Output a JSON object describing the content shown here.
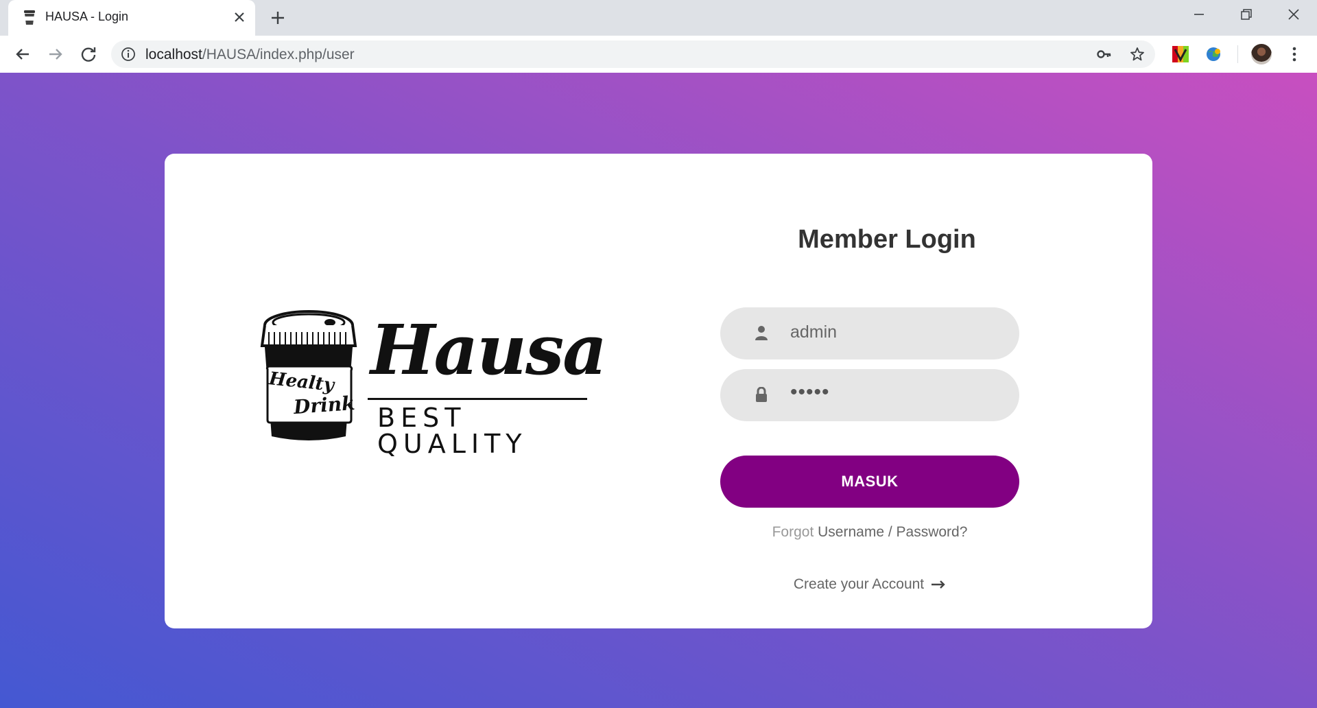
{
  "browser": {
    "tab_title": "HAUSA - Login",
    "url_host": "localhost",
    "url_path": "/HAUSA/index.php/user"
  },
  "login": {
    "title": "Member Login",
    "username_value": "admin",
    "password_value": "•••••",
    "submit_label": "MASUK",
    "forgot_prefix": "Forgot",
    "forgot_link": "Username / Password?",
    "create_account": "Create your Account"
  },
  "logo": {
    "wordmark": "Hausa",
    "tagline": "BEST QUALITY",
    "cup_text_1": "Healty",
    "cup_text_2": "Drink"
  },
  "colors": {
    "primary_button": "#820082",
    "gradient_start": "#4458d2",
    "gradient_end": "#c84fc0"
  }
}
